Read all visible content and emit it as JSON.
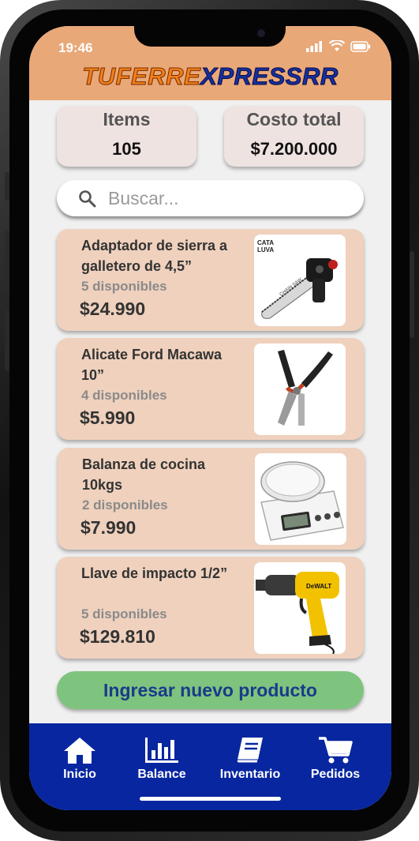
{
  "status_bar": {
    "time": "19:46"
  },
  "app": {
    "title_part1": "TUFERRE",
    "title_part2": "XPRESSRR"
  },
  "stats": {
    "items_label": "Items",
    "items_value": "105",
    "cost_label": "Costo total",
    "cost_value": "$7.200.000"
  },
  "search": {
    "placeholder": "Buscar..."
  },
  "products": [
    {
      "name": "Adaptador de sierra a galletero de 4,5”",
      "stock": "5 disponibles",
      "price": "$24.990",
      "image": "chainsaw-adapter"
    },
    {
      "name": "Alicate Ford Macawa 10”",
      "stock": "4 disponibles",
      "price": "$5.990",
      "image": "pliers"
    },
    {
      "name": "Balanza de cocina 10kgs",
      "stock": "2 disponibles",
      "price": "$7.990",
      "image": "kitchen-scale"
    },
    {
      "name": "Llave de impacto 1/2”",
      "stock": "5 disponibles",
      "price": "$129.810",
      "image": "impact-wrench"
    }
  ],
  "add_button": {
    "label": "Ingresar nuevo producto"
  },
  "nav": [
    {
      "label": "Inicio",
      "icon": "home-icon"
    },
    {
      "label": "Balance",
      "icon": "bar-chart-icon"
    },
    {
      "label": "Inventario",
      "icon": "book-icon"
    },
    {
      "label": "Pedidos",
      "icon": "cart-icon"
    }
  ],
  "colors": {
    "header": "#e8a878",
    "card": "#efd1bd",
    "nav": "#0726a0",
    "cta": "#7ec47e",
    "logo_orange": "#f08018",
    "logo_blue": "#1530a0"
  }
}
